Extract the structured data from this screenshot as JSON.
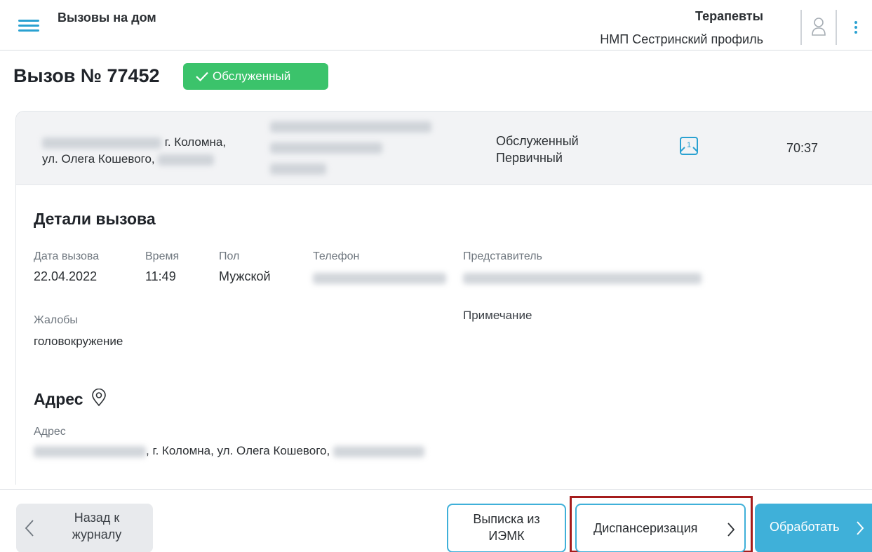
{
  "header": {
    "title": "Вызовы на дом",
    "department": "Терапевты",
    "profile": "НМП Сестринский профиль"
  },
  "call": {
    "title": "Вызов № 77452",
    "status_badge": "Обслуженный"
  },
  "summary": {
    "address_city": "г. Коломна,",
    "address_street": "ул. Олега Кошевого,",
    "status": "Обслуженный",
    "type": "Первичный",
    "timer": "70:37"
  },
  "details": {
    "heading": "Детали вызова",
    "date_label": "Дата вызова",
    "date_value": "22.04.2022",
    "time_label": "Время",
    "time_value": "11:49",
    "sex_label": "Пол",
    "sex_value": "Мужской",
    "phone_label": "Телефон",
    "representative_label": "Представитель",
    "complaints_label": "Жалобы",
    "complaints_value": "головокружение",
    "note_label": "Примечание"
  },
  "address": {
    "heading": "Адрес",
    "label": "Адрес",
    "value": ", г. Коломна, ул. Олега Кошевого,"
  },
  "footer": {
    "back_line1": "Назад к",
    "back_line2": "журналу",
    "extract_line1": "Выписка из",
    "extract_line2": "ИЭМК",
    "dispensary": "Диспансеризация",
    "process": "Обработать"
  },
  "colors": {
    "accent": "#3fb0d9",
    "status_green": "#3bc36b",
    "highlight_red": "#a51c1c"
  }
}
